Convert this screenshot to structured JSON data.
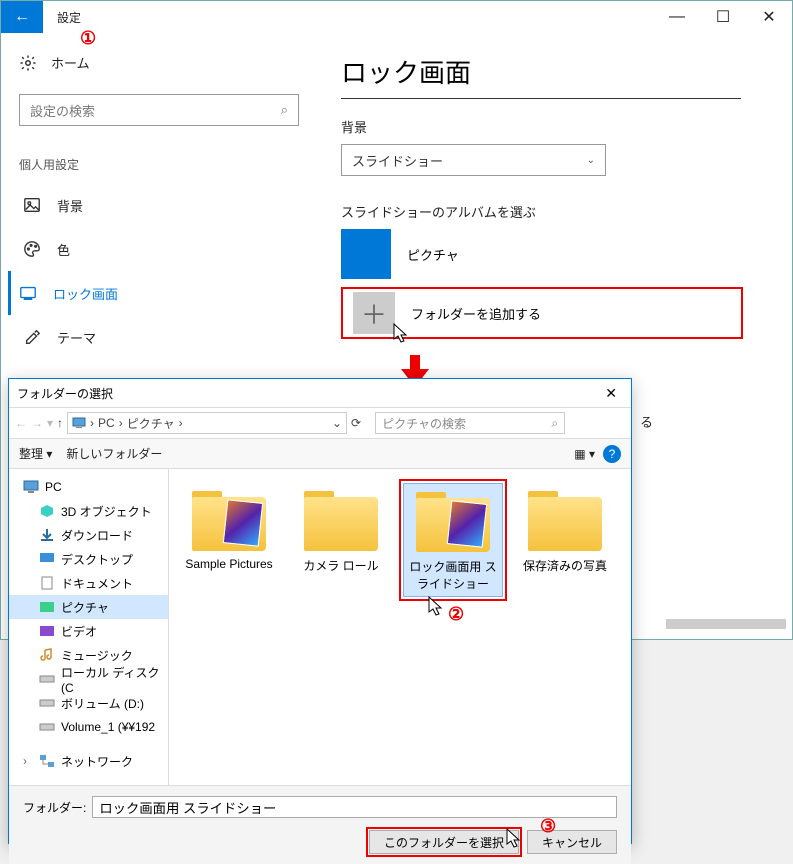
{
  "window": {
    "title": "設定",
    "back_icon": "←",
    "controls": {
      "min": "—",
      "max": "☐",
      "close": "✕"
    }
  },
  "sidebar": {
    "home": "ホーム",
    "search_placeholder": "設定の検索",
    "section": "個人用設定",
    "items": [
      {
        "label": "背景",
        "icon": "image"
      },
      {
        "label": "色",
        "icon": "palette"
      },
      {
        "label": "ロック画面",
        "icon": "lock",
        "active": true
      },
      {
        "label": "テーマ",
        "icon": "theme"
      }
    ]
  },
  "content": {
    "page_title": "ロック画面",
    "bg_label": "背景",
    "bg_value": "スライドショー",
    "album_label": "スライドショーのアルバムを選ぶ",
    "album_name": "ピクチャ",
    "add_folder": "フォルダーを追加する"
  },
  "dialog": {
    "title": "フォルダーの選択",
    "path": {
      "root": "PC",
      "sep": "›",
      "child": "ピクチャ"
    },
    "search_placeholder": "ピクチャの検索",
    "organize": "整理",
    "new_folder": "新しいフォルダー",
    "tree": {
      "pc": "PC",
      "items": [
        "3D オブジェクト",
        "ダウンロード",
        "デスクトップ",
        "ドキュメント",
        "ピクチャ",
        "ビデオ",
        "ミュージック",
        "ローカル ディスク (C",
        "ボリューム (D:)",
        "Volume_1 (¥¥192"
      ],
      "network": "ネットワーク"
    },
    "folders": [
      {
        "label": "Sample Pictures",
        "thumb": true
      },
      {
        "label": "カメラ ロール",
        "thumb": false
      },
      {
        "label": "ロック画面用 スライドショー",
        "thumb": true,
        "selected": true
      },
      {
        "label": "保存済みの写真",
        "thumb": false
      }
    ],
    "folder_label": "フォルダー:",
    "folder_value": "ロック画面用 スライドショー",
    "select_btn": "このフォルダーを選択",
    "cancel_btn": "キャンセル"
  },
  "annotations": {
    "n1": "①",
    "n2": "②",
    "n3": "③"
  },
  "extra_text": "る"
}
